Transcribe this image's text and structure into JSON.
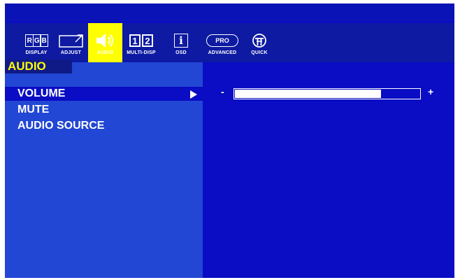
{
  "tabs": [
    {
      "id": "display",
      "label": "DISPLAY",
      "icon": "rgb-icon",
      "glyphs": [
        "R",
        "G",
        "B"
      ]
    },
    {
      "id": "adjust",
      "label": "ADJUST",
      "icon": "adjust-window-icon"
    },
    {
      "id": "audio",
      "label": "AUDIO",
      "icon": "speaker-icon",
      "active": true
    },
    {
      "id": "multi",
      "label": "MULTI-DISP",
      "icon": "multi-display-icon",
      "glyphs": [
        "1",
        "2"
      ]
    },
    {
      "id": "osd",
      "label": "OSD",
      "icon": "info-icon",
      "glyph": "i"
    },
    {
      "id": "advanced",
      "label": "ADVANCED",
      "icon": "pro-icon",
      "glyph": "PRO"
    },
    {
      "id": "quick",
      "label": "QUICK",
      "icon": "tool-icon"
    }
  ],
  "section_title": "AUDIO",
  "menu_items": [
    {
      "label": "VOLUME",
      "selected": true
    },
    {
      "label": "MUTE"
    },
    {
      "label": "AUDIO SOURCE"
    }
  ],
  "volume": {
    "minus": "-",
    "plus": "+",
    "level": 0.79
  },
  "colors": {
    "background": "#0a0dc4",
    "left_panel": "#2247d4",
    "active_tab": "#ffff00",
    "section_title": "#ffff00",
    "text": "#ffffff"
  }
}
